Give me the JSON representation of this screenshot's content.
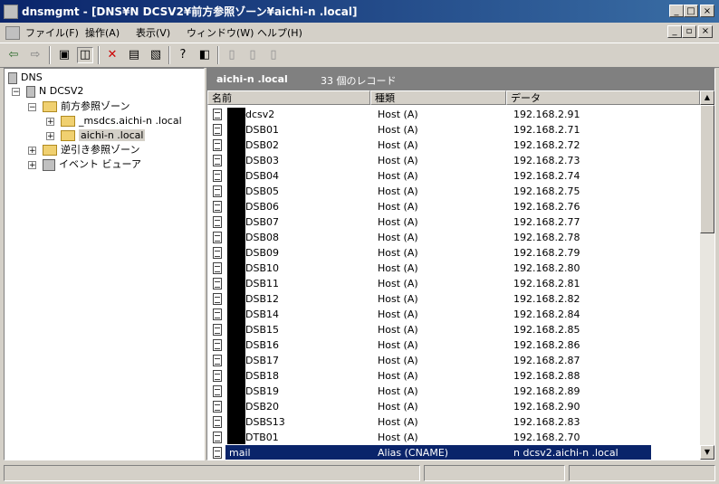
{
  "window": {
    "title": "dnsmgmt - [DNS¥N DCSV2¥前方参照ゾーン¥aichi-n .local]"
  },
  "menubar": {
    "items": [
      "ファイル(F)",
      "操作(A)",
      "表示(V)",
      "ウィンドウ(W)",
      "ヘルプ(H)"
    ]
  },
  "tree": {
    "root": "DNS",
    "server": "N DCSV2",
    "forward_zone": "前方参照ゾーン",
    "msdcs": "_msdcs.aichi-n .local",
    "zone": "aichi-n .local",
    "reverse_zone": "逆引き参照ゾーン",
    "event_viewer": "イベント ビューア"
  },
  "panel": {
    "zone_name": "aichi-n .local",
    "record_count": "33 個のレコード"
  },
  "columns": [
    "名前",
    "種類",
    "データ"
  ],
  "records": [
    {
      "name": "dcsv2",
      "type": "Host (A)",
      "data": "192.168.2.91"
    },
    {
      "name": "DSB01",
      "type": "Host (A)",
      "data": "192.168.2.71"
    },
    {
      "name": "DSB02",
      "type": "Host (A)",
      "data": "192.168.2.72"
    },
    {
      "name": "DSB03",
      "type": "Host (A)",
      "data": "192.168.2.73"
    },
    {
      "name": "DSB04",
      "type": "Host (A)",
      "data": "192.168.2.74"
    },
    {
      "name": "DSB05",
      "type": "Host (A)",
      "data": "192.168.2.75"
    },
    {
      "name": "DSB06",
      "type": "Host (A)",
      "data": "192.168.2.76"
    },
    {
      "name": "DSB07",
      "type": "Host (A)",
      "data": "192.168.2.77"
    },
    {
      "name": "DSB08",
      "type": "Host (A)",
      "data": "192.168.2.78"
    },
    {
      "name": "DSB09",
      "type": "Host (A)",
      "data": "192.168.2.79"
    },
    {
      "name": "DSB10",
      "type": "Host (A)",
      "data": "192.168.2.80"
    },
    {
      "name": "DSB11",
      "type": "Host (A)",
      "data": "192.168.2.81"
    },
    {
      "name": "DSB12",
      "type": "Host (A)",
      "data": "192.168.2.82"
    },
    {
      "name": "DSB14",
      "type": "Host (A)",
      "data": "192.168.2.84"
    },
    {
      "name": "DSB15",
      "type": "Host (A)",
      "data": "192.168.2.85"
    },
    {
      "name": "DSB16",
      "type": "Host (A)",
      "data": "192.168.2.86"
    },
    {
      "name": "DSB17",
      "type": "Host (A)",
      "data": "192.168.2.87"
    },
    {
      "name": "DSB18",
      "type": "Host (A)",
      "data": "192.168.2.88"
    },
    {
      "name": "DSB19",
      "type": "Host (A)",
      "data": "192.168.2.89"
    },
    {
      "name": "DSB20",
      "type": "Host (A)",
      "data": "192.168.2.90"
    },
    {
      "name": "DSBS13",
      "type": "Host (A)",
      "data": "192.168.2.83"
    },
    {
      "name": "DTB01",
      "type": "Host (A)",
      "data": "192.168.2.70"
    },
    {
      "name": "mail",
      "type": "Alias (CNAME)",
      "data": "n dcsv2.aichi-n .local"
    }
  ],
  "colors": {
    "titlebar": "#0a246a",
    "selection": "#0a246a",
    "face": "#d4d0c8"
  },
  "icons": [
    "dns-app-icon",
    "back-icon",
    "forward-icon",
    "up-folder-icon",
    "show-tree-icon",
    "delete-icon",
    "properties-icon",
    "export-icon",
    "help-icon",
    "console-icon",
    "new-host-icon",
    "new-alias-icon",
    "new-mx-icon"
  ]
}
